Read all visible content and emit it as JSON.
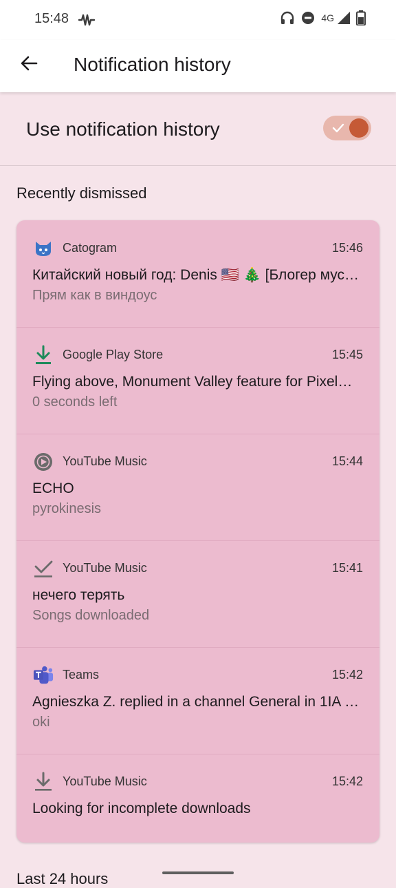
{
  "status": {
    "time": "15:48",
    "network": "4G"
  },
  "header": {
    "title": "Notification history"
  },
  "settings": {
    "toggle_label": "Use notification history",
    "toggle_on": true,
    "accent_color": "#c55a36"
  },
  "sections": {
    "recent": "Recently dismissed",
    "last24": "Last 24 hours"
  },
  "notifications": [
    {
      "app": "Catogram",
      "icon": "cat-icon",
      "time": "15:46",
      "title": "Китайский новый год: Denis 🇺🇸 🎄 [Блогер мус…",
      "text": "Прям как в виндоус"
    },
    {
      "app": "Google Play Store",
      "icon": "download-icon",
      "time": "15:45",
      "title": "Flying above, Monument Valley feature for Pixel…",
      "text": "0 seconds left"
    },
    {
      "app": "YouTube Music",
      "icon": "play-circle-icon",
      "time": "15:44",
      "title": "ECHO",
      "text": "pyrokinesis"
    },
    {
      "app": "YouTube Music",
      "icon": "check-icon",
      "time": "15:41",
      "title": "нечего терять",
      "text": "Songs downloaded"
    },
    {
      "app": "Teams",
      "icon": "teams-icon",
      "time": "15:42",
      "title": "Agnieszka Z. replied in a channel General in 1IA F…",
      "text": "oki"
    },
    {
      "app": "YouTube Music",
      "icon": "download-icon",
      "time": "15:42",
      "title": "Looking for incomplete downloads",
      "text": ""
    }
  ]
}
